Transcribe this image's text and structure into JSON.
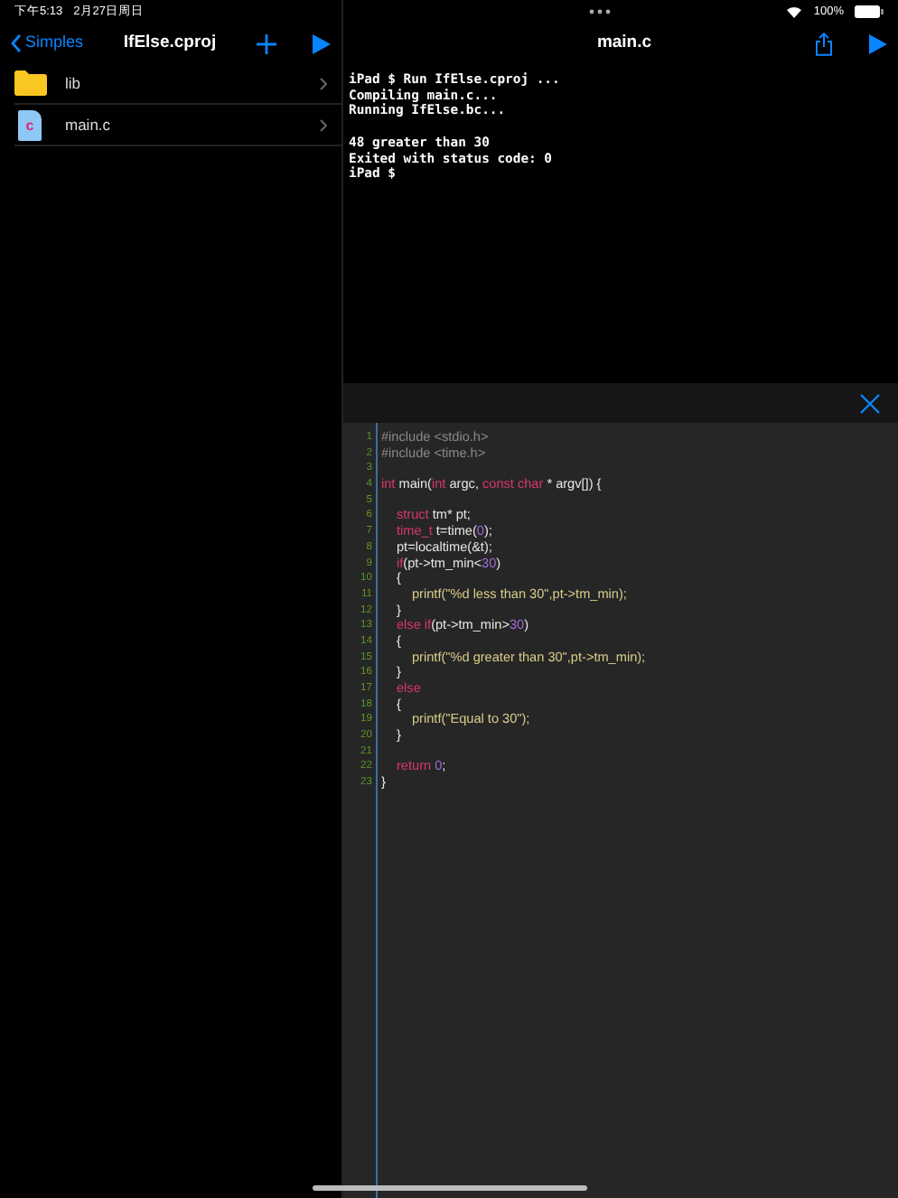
{
  "status_bar": {
    "time": "下午5:13",
    "date": "2月27日周日",
    "battery": "100%"
  },
  "sidebar": {
    "back": "Simples",
    "title": "IfElse.cproj",
    "items": [
      {
        "kind": "folder",
        "name": "lib"
      },
      {
        "kind": "cfile",
        "badge": "c",
        "name": "main.c"
      }
    ]
  },
  "editor": {
    "title": "main.c",
    "terminal": [
      {
        "lines": [
          "iPad $ Run IfElse.cproj ...",
          "Compiling main.c...",
          "Running IfElse.bc..."
        ]
      },
      {
        "lines": [
          "48 greater than 30",
          "Exited with status code: 0",
          "iPad $"
        ]
      }
    ],
    "code": [
      {
        "number": "1",
        "tokens": [
          {
            "kind": "comment",
            "text": "#include <stdio.h>"
          }
        ]
      },
      {
        "number": "2",
        "tokens": [
          {
            "kind": "comment",
            "text": "#include <time.h>"
          }
        ]
      },
      {
        "number": "3"
      },
      {
        "number": "4",
        "tokens": [
          {
            "kind": "keyword",
            "text": "int"
          },
          {
            "kind": "plain",
            "text": " main("
          },
          {
            "kind": "keyword",
            "text": "int"
          },
          {
            "kind": "plain",
            "text": " argc, "
          },
          {
            "kind": "keyword",
            "text": "const char"
          },
          {
            "kind": "plain",
            "text": " * argv[]) {"
          }
        ],
        "children": [
          {
            "number": "5"
          },
          {
            "number": "6",
            "tokens": [
              {
                "kind": "keyword",
                "text": "struct"
              },
              {
                "kind": "plain",
                "text": " tm* pt;"
              }
            ]
          },
          {
            "number": "7",
            "tokens": [
              {
                "kind": "keyword",
                "text": "time_t"
              },
              {
                "kind": "plain",
                "text": " t=time("
              },
              {
                "kind": "number",
                "text": "0"
              },
              {
                "kind": "plain",
                "text": ");"
              }
            ]
          },
          {
            "number": "8",
            "tokens": [
              {
                "kind": "plain",
                "text": "pt=localtime(&t);"
              }
            ]
          },
          {
            "number": "9",
            "tokens": [
              {
                "kind": "keyword",
                "text": "if"
              },
              {
                "kind": "plain",
                "text": "(pt->tm_min<"
              },
              {
                "kind": "number",
                "text": "30"
              },
              {
                "kind": "plain",
                "text": ")"
              }
            ]
          },
          {
            "number": "10",
            "tokens": [
              {
                "kind": "plain",
                "text": "{"
              }
            ],
            "children": [
              {
                "number": "11",
                "tokens": [
                  {
                    "kind": "string",
                    "text": "printf(\"%d less than 30\",pt->tm_min);"
                  }
                ]
              }
            ]
          },
          {
            "number": "12",
            "tokens": [
              {
                "kind": "plain",
                "text": "}"
              }
            ]
          },
          {
            "number": "13",
            "tokens": [
              {
                "kind": "keyword",
                "text": "else if"
              },
              {
                "kind": "plain",
                "text": "(pt->tm_min>"
              },
              {
                "kind": "number",
                "text": "30"
              },
              {
                "kind": "plain",
                "text": ")"
              }
            ]
          },
          {
            "number": "14",
            "tokens": [
              {
                "kind": "plain",
                "text": "{"
              }
            ],
            "children": [
              {
                "number": "15",
                "tokens": [
                  {
                    "kind": "string",
                    "text": "printf(\"%d greater than 30\",pt->tm_min);"
                  }
                ]
              }
            ]
          },
          {
            "number": "16",
            "tokens": [
              {
                "kind": "plain",
                "text": "}"
              }
            ]
          },
          {
            "number": "17",
            "tokens": [
              {
                "kind": "keyword",
                "text": "else"
              }
            ]
          },
          {
            "number": "18",
            "tokens": [
              {
                "kind": "plain",
                "text": "{"
              }
            ],
            "children": [
              {
                "number": "19",
                "tokens": [
                  {
                    "kind": "string",
                    "text": "printf(\"Equal to 30\");"
                  }
                ]
              }
            ]
          },
          {
            "number": "20",
            "tokens": [
              {
                "kind": "plain",
                "text": "}"
              }
            ]
          },
          {
            "number": "21"
          },
          {
            "number": "22",
            "tokens": [
              {
                "kind": "keyword",
                "text": "return"
              },
              {
                "kind": "number",
                "text": "0",
                "spaced": true
              },
              {
                "kind": "plain",
                "text": ";"
              }
            ]
          }
        ]
      },
      {
        "number": "23",
        "tokens": [
          {
            "kind": "plain",
            "text": "}"
          }
        ]
      }
    ]
  }
}
